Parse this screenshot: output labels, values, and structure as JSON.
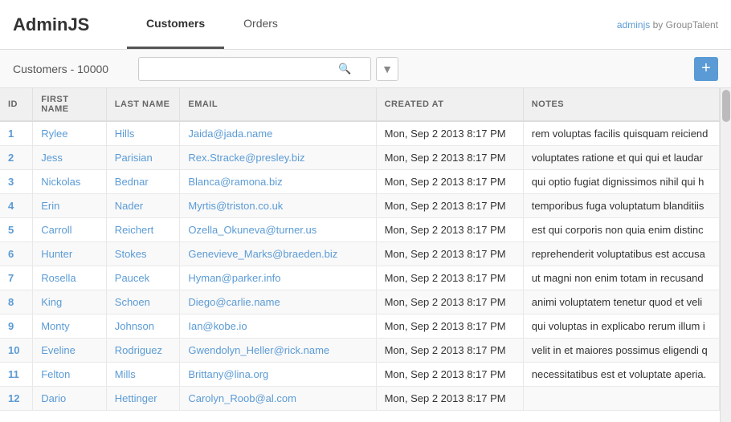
{
  "header": {
    "logo": "AdminJS",
    "tabs": [
      {
        "label": "Customers",
        "active": true
      },
      {
        "label": "Orders",
        "active": false
      }
    ],
    "brand": "adminjs",
    "by": " by ",
    "group": "GroupTalent"
  },
  "toolbar": {
    "title": "Customers - 10000",
    "search_placeholder": "",
    "add_label": "+"
  },
  "table": {
    "columns": [
      "ID",
      "FIRST NAME",
      "LAST NAME",
      "EMAIL",
      "CREATED AT",
      "NOTES"
    ],
    "rows": [
      {
        "id": "1",
        "first": "Rylee",
        "last": "Hills",
        "email": "Jaida@jada.name",
        "created": "Mon, Sep 2 2013 8:17 PM",
        "notes": "rem voluptas facilis quisquam reiciend"
      },
      {
        "id": "2",
        "first": "Jess",
        "last": "Parisian",
        "email": "Rex.Stracke@presley.biz",
        "created": "Mon, Sep 2 2013 8:17 PM",
        "notes": "voluptates ratione et qui qui et laudar"
      },
      {
        "id": "3",
        "first": "Nickolas",
        "last": "Bednar",
        "email": "Blanca@ramona.biz",
        "created": "Mon, Sep 2 2013 8:17 PM",
        "notes": "qui optio fugiat dignissimos nihil qui h"
      },
      {
        "id": "4",
        "first": "Erin",
        "last": "Nader",
        "email": "Myrtis@triston.co.uk",
        "created": "Mon, Sep 2 2013 8:17 PM",
        "notes": "temporibus fuga voluptatum blanditiis"
      },
      {
        "id": "5",
        "first": "Carroll",
        "last": "Reichert",
        "email": "Ozella_Okuneva@turner.us",
        "created": "Mon, Sep 2 2013 8:17 PM",
        "notes": "est qui corporis non quia enim distinc"
      },
      {
        "id": "6",
        "first": "Hunter",
        "last": "Stokes",
        "email": "Genevieve_Marks@braeden.biz",
        "created": "Mon, Sep 2 2013 8:17 PM",
        "notes": "reprehenderit voluptatibus est accusa"
      },
      {
        "id": "7",
        "first": "Rosella",
        "last": "Paucek",
        "email": "Hyman@parker.info",
        "created": "Mon, Sep 2 2013 8:17 PM",
        "notes": "ut magni non enim totam in recusand"
      },
      {
        "id": "8",
        "first": "King",
        "last": "Schoen",
        "email": "Diego@carlie.name",
        "created": "Mon, Sep 2 2013 8:17 PM",
        "notes": "animi voluptatem tenetur quod et veli"
      },
      {
        "id": "9",
        "first": "Monty",
        "last": "Johnson",
        "email": "Ian@kobe.io",
        "created": "Mon, Sep 2 2013 8:17 PM",
        "notes": "qui voluptas in explicabo rerum illum i"
      },
      {
        "id": "10",
        "first": "Eveline",
        "last": "Rodriguez",
        "email": "Gwendolyn_Heller@rick.name",
        "created": "Mon, Sep 2 2013 8:17 PM",
        "notes": "velit in et maiores possimus eligendi q"
      },
      {
        "id": "11",
        "first": "Felton",
        "last": "Mills",
        "email": "Brittany@lina.org",
        "created": "Mon, Sep 2 2013 8:17 PM",
        "notes": "necessitatibus est et voluptate aperia."
      },
      {
        "id": "12",
        "first": "Dario",
        "last": "Hettinger",
        "email": "Carolyn_Roob@al.com",
        "created": "Mon, Sep 2 2013 8:17 PM",
        "notes": ""
      }
    ]
  }
}
